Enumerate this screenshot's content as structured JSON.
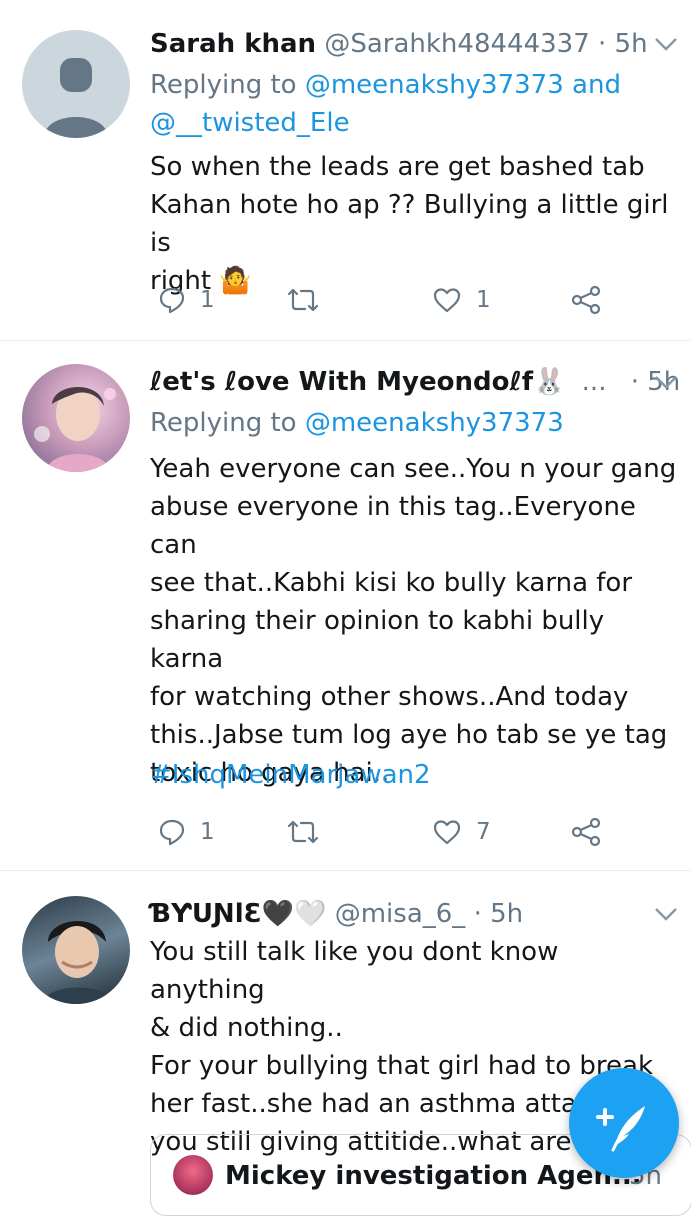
{
  "tweets": [
    {
      "name": "Sarah khan",
      "handle": "@Sarahkh48444337",
      "dot": "·",
      "time": "5h",
      "replying_prefix": "Replying to",
      "mention1": "@meenakshy37373",
      "joiner": "and",
      "mention2": "@__twisted_Ele",
      "body_lines": [
        "So when the leads are get bashed tab",
        "Kahan hote ho ap ?? Bullying a little girl is",
        "right 🤷"
      ],
      "reply_count": "1",
      "like_count": "1"
    },
    {
      "name": "ℓet's ℓove With Myeondoℓf🐰",
      "ellipsis": "...",
      "dot": "·",
      "time": "5h",
      "replying_prefix": "Replying to",
      "mention1": "@meenakshy37373",
      "body_lines": [
        "Yeah everyone can see..You n your gang",
        "abuse everyone in this tag..Everyone can",
        "see that..Kabhi kisi ko bully karna for",
        "sharing their opinion to kabhi bully karna",
        "for watching other shows..And today",
        "this..Jabse tum log aye ho tab se ye tag",
        "toxic ho gaya hai.."
      ],
      "hashtag": "#IshqMeinMarjawan2",
      "reply_count": "1",
      "like_count": "7"
    },
    {
      "name": "ƁƳUƝlƐ🖤🤍",
      "handle": "@misa_6_",
      "dot": "·",
      "time": "5h",
      "body_lines": [
        "You still talk like you dont know anything",
        "& did nothing..",
        "For your bullying that girl had to break",
        "her fast..she had an asthma attack &",
        "you still giving attitide..what are"
      ],
      "quote_name": "Mickey investigation Agen...",
      "quote_time": "5h"
    }
  ],
  "colors": {
    "accent": "#1b95e0",
    "secondary": "#657786",
    "fab": "#1da1f2"
  },
  "icons": [
    "chevron-down-icon",
    "reply-icon",
    "retweet-icon",
    "like-icon",
    "share-icon",
    "compose-icon"
  ]
}
